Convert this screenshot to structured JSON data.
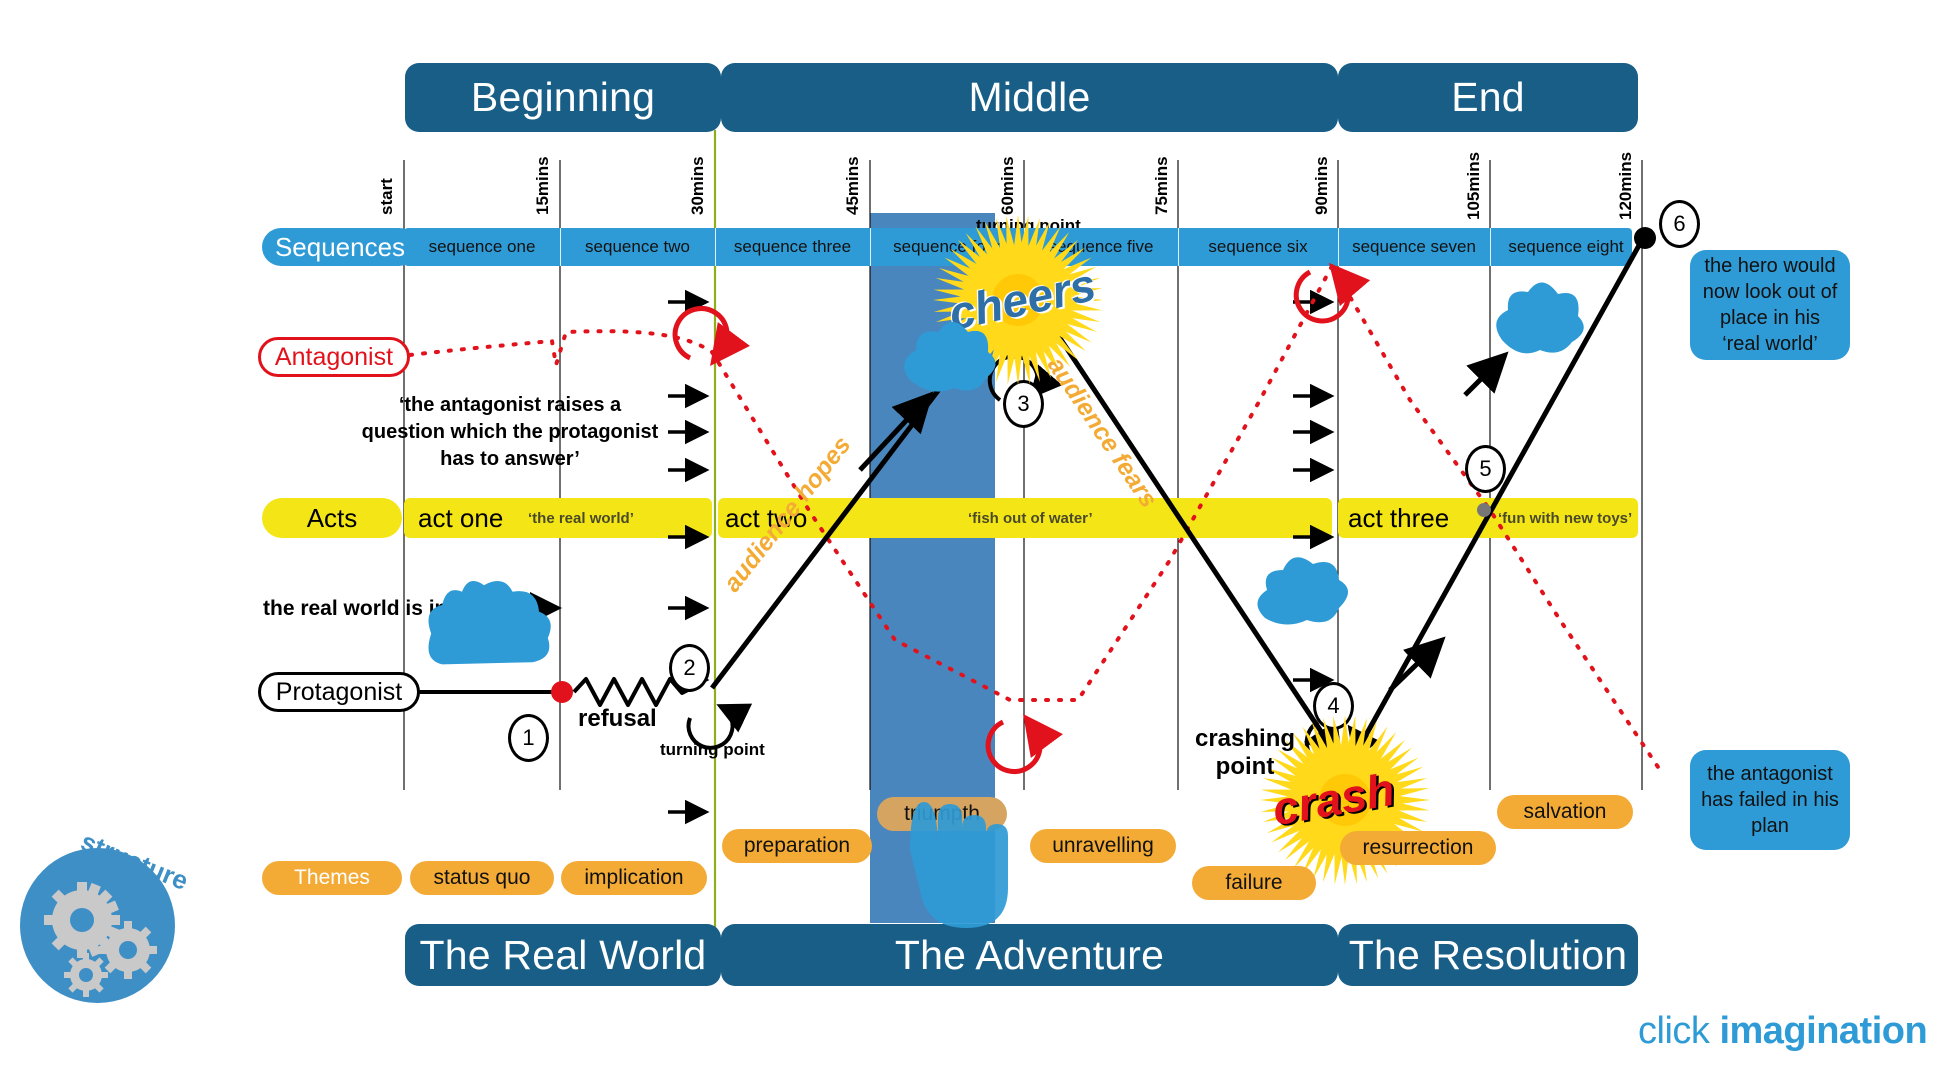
{
  "acts_header": {
    "beginning": "Beginning",
    "middle": "Middle",
    "end": "End"
  },
  "bottom_header": {
    "real_world": "The Real World",
    "adventure": "The Adventure",
    "resolution": "The Resolution"
  },
  "timeline": {
    "ticks": [
      "start",
      "15mins",
      "30mins",
      "45mins",
      "60mins",
      "75mins",
      "90mins",
      "105mins",
      "120mins"
    ]
  },
  "sequences": {
    "label": "Sequences",
    "items": [
      "sequence one",
      "sequence two",
      "sequence three",
      "sequence four",
      "sequence five",
      "sequence six",
      "sequence seven",
      "sequence eight"
    ],
    "turning_point": "turning point"
  },
  "acts": {
    "label": "Acts",
    "items": [
      {
        "name": "act one",
        "subtitle": "‘the real world’"
      },
      {
        "name": "act two",
        "subtitle": "‘fish out of water’"
      },
      {
        "name": "act three",
        "subtitle": "‘fun with new toys’"
      }
    ]
  },
  "themes": {
    "label": "Themes",
    "items": [
      "status quo",
      "implication",
      "preparation",
      "triumpth",
      "unravelling",
      "failure",
      "resurrection",
      "salvation"
    ]
  },
  "characters": {
    "antagonist": "Antagonist",
    "protagonist": "Protagonist"
  },
  "annotations": {
    "antagonist_question": "‘the antagonist raises a question which the protagonist has to answer’",
    "peril": "the real world is in peril",
    "refusal": "refusal",
    "turning_point_small": "turning point",
    "crashing_point": "crashing point",
    "audience_hopes": "audience hopes",
    "audience_fears": "audience fears",
    "cheers": "cheers",
    "crash": "crash"
  },
  "callouts": {
    "hero_out_of_place": "the hero would now look out of place in his ‘real world’",
    "antagonist_failed": "the antagonist has failed in his plan"
  },
  "beats": [
    "1",
    "2",
    "3",
    "4",
    "5",
    "6"
  ],
  "logo": {
    "structure_word": "structure",
    "brand_light": "click ",
    "brand_bold": "imagination"
  },
  "colors": {
    "dark_blue": "#185E86",
    "mid_blue": "#2E9BD6",
    "yellow": "#F4E616",
    "orange": "#F3AB36",
    "red": "#E1121B",
    "green_line": "#8FAE1B",
    "band_blue": "#4A86BE"
  }
}
